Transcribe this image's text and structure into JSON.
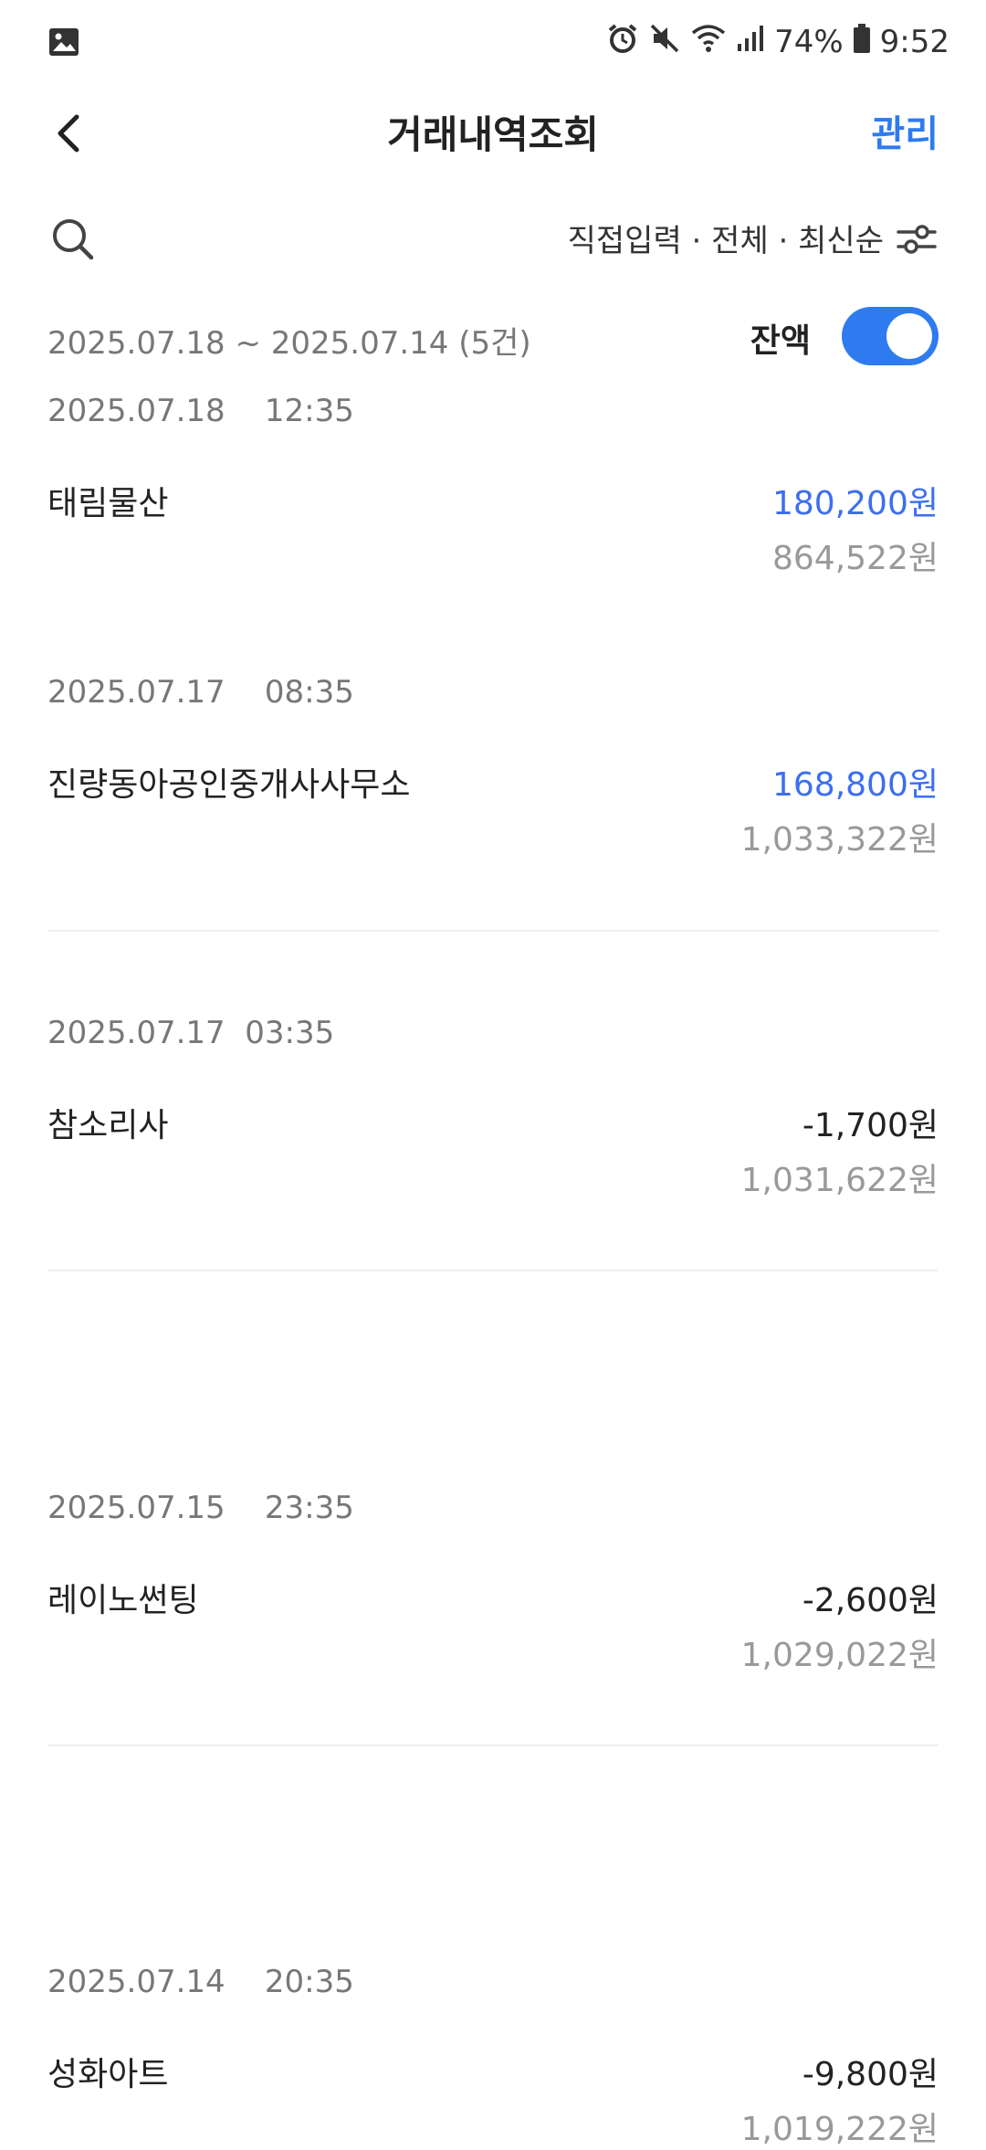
{
  "status_bar": {
    "battery": "74%",
    "time": "9:52",
    "icons": [
      "gallery-icon",
      "alarm-icon",
      "mute-icon",
      "wifi-icon",
      "signal-icon",
      "battery-icon"
    ]
  },
  "header": {
    "title": "거래내역조회",
    "manage_label": "관리"
  },
  "filter": {
    "text": "직접입력 · 전체 · 최신순"
  },
  "summary": {
    "range": "2025.07.18 ~ 2025.07.14 (5건)",
    "balance_label": "잔액",
    "balance_toggle_on": true
  },
  "colors": {
    "accent": "#2d7bef",
    "deposit": "#3c6ef0",
    "muted": "#999999"
  },
  "transactions": [
    {
      "datetime": "2025.07.18    12:35",
      "merchant": "태림물산",
      "amount": "180,200원",
      "balance": "864,522원",
      "type": "deposit"
    },
    {
      "datetime": "2025.07.17    08:35",
      "merchant": "진량동아공인중개사사무소",
      "amount": "168,800원",
      "balance": "1,033,322원",
      "type": "deposit"
    },
    {
      "datetime": "2025.07.17  03:35",
      "merchant": "참소리사",
      "amount": "-1,700원",
      "balance": "1,031,622원",
      "type": "withdrawal"
    },
    {
      "datetime": "2025.07.15    23:35",
      "merchant": "레이노썬팅",
      "amount": "-2,600원",
      "balance": "1,029,022원",
      "type": "withdrawal"
    },
    {
      "datetime": "2025.07.14    20:35",
      "merchant": "성화아트",
      "amount": "-9,800원",
      "balance": "1,019,222원",
      "type": "withdrawal"
    }
  ]
}
